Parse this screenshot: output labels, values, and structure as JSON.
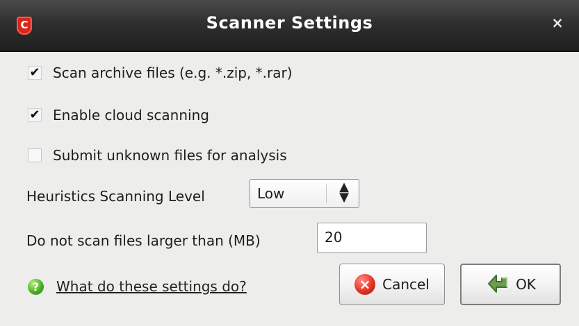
{
  "window": {
    "title": "Scanner Settings",
    "app_icon": "comodo-shield-icon",
    "close_label": "×"
  },
  "options": [
    {
      "label": "Scan archive files (e.g. *.zip, *.rar)",
      "checked": true
    },
    {
      "label": "Enable cloud scanning",
      "checked": true
    },
    {
      "label": "Submit unknown files for analysis",
      "checked": false
    }
  ],
  "heuristics": {
    "label": "Heuristics Scanning Level",
    "selected": "Low"
  },
  "size_limit": {
    "label": "Do not scan files larger than (MB)",
    "value": "20"
  },
  "help": {
    "icon": "question-icon",
    "link": "What do these settings do?"
  },
  "buttons": {
    "cancel": "Cancel",
    "ok": "OK"
  },
  "colors": {
    "titlebar": "#2f2f2f",
    "accent_red": "#e53426",
    "accent_green": "#4caf26"
  }
}
